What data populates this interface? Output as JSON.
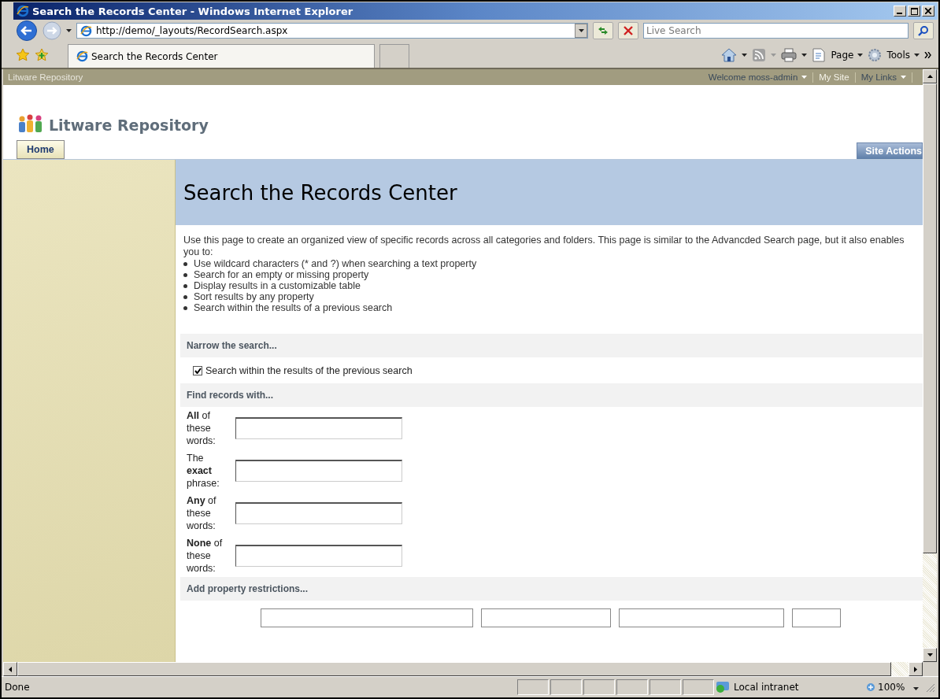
{
  "window": {
    "title": "Search the Records Center - Windows Internet Explorer"
  },
  "address_bar": {
    "url": "http://demo/_layouts/RecordSearch.aspx"
  },
  "search_box": {
    "placeholder": "Live Search"
  },
  "tabs": [
    {
      "label": "Search the Records Center",
      "selected": true
    }
  ],
  "command_bar": [
    {
      "label": "Page"
    },
    {
      "label": "Tools"
    }
  ],
  "site": {
    "top_bar_title": "Litware Repository",
    "welcome": "Welcome moss-admin",
    "links": [
      "My Site",
      "My Links"
    ],
    "site_title": "Litware Repository",
    "nav_tabs": [
      {
        "label": "Home",
        "selected": true
      }
    ],
    "site_actions": "Site Actions"
  },
  "page": {
    "title": "Search the Records Center",
    "intro": "Use this page to create an organized view of specific records across all categories and folders. This page is similar to the Advancded Search page, but it also enables you to:",
    "bullets": [
      "Use wildcard characters (* and ?) when searching a text property",
      "Search for an empty or missing property",
      "Display results in a customizable table",
      "Sort results by any property",
      "Search within the results of a previous search"
    ],
    "sections": [
      {
        "heading": "Narrow the search...",
        "kind": "checkbox",
        "label": "Search within the results of the previous search",
        "checked": true
      },
      {
        "heading": "Find records with...",
        "kind": "fields",
        "fields": [
          {
            "label": "**All** of these words:"
          },
          {
            "label": "The **exact** phrase:"
          },
          {
            "label": "**Any** of these words:"
          },
          {
            "label": "**None** of these words:"
          }
        ]
      },
      {
        "heading": "Add property restrictions...",
        "kind": "restrictions"
      }
    ]
  },
  "status_bar": {
    "text": "Done",
    "zone": "Local intranet",
    "zoom": "100%"
  }
}
